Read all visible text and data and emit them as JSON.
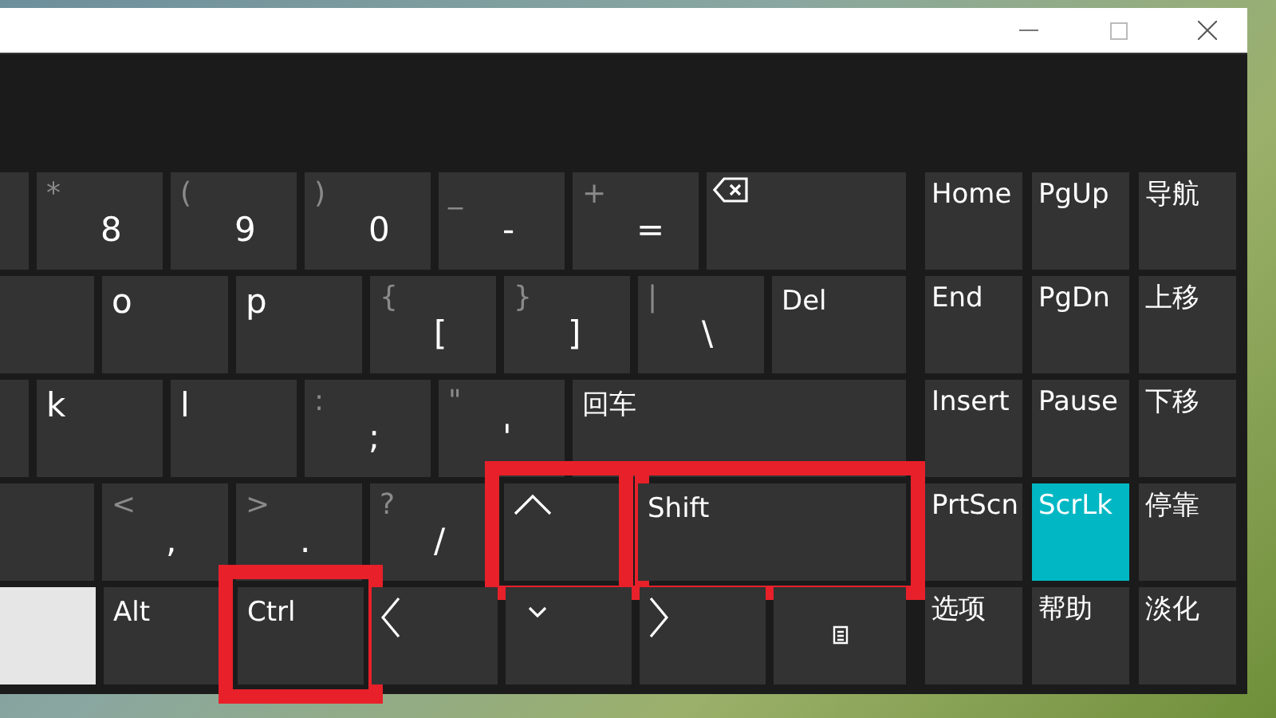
{
  "main_rows": [
    {
      "keys": [
        {
          "kind": "blank",
          "pressed": false,
          "highlighted": false
        },
        {
          "kind": "symbol",
          "shift": "*",
          "main": "8",
          "pressed": false,
          "highlighted": false
        },
        {
          "kind": "symbol",
          "shift": "(",
          "main": "9",
          "pressed": false,
          "highlighted": false
        },
        {
          "kind": "symbol",
          "shift": ")",
          "main": "0",
          "pressed": false,
          "highlighted": false
        },
        {
          "kind": "symbol",
          "shift": "_",
          "main": "-",
          "pressed": false,
          "highlighted": false
        },
        {
          "kind": "symbol",
          "shift": "+",
          "main": "=",
          "pressed": false,
          "highlighted": false
        },
        {
          "kind": "backspace",
          "pressed": false,
          "highlighted": false
        }
      ]
    },
    {
      "keys": [
        {
          "kind": "blank",
          "pressed": false,
          "highlighted": false
        },
        {
          "kind": "label",
          "label": "o",
          "pressed": false,
          "highlighted": false
        },
        {
          "kind": "label",
          "label": "p",
          "pressed": false,
          "highlighted": false
        },
        {
          "kind": "symbol",
          "shift": "{",
          "main": "[",
          "pressed": false,
          "highlighted": false
        },
        {
          "kind": "symbol",
          "shift": "}",
          "main": "]",
          "pressed": false,
          "highlighted": false
        },
        {
          "kind": "symbol",
          "shift": "|",
          "main": "\\",
          "pressed": false,
          "highlighted": false
        },
        {
          "kind": "label",
          "label": "Del",
          "pressed": false,
          "highlighted": false
        }
      ]
    },
    {
      "keys": [
        {
          "kind": "blank",
          "pressed": false,
          "highlighted": false
        },
        {
          "kind": "label",
          "label": "k",
          "pressed": false,
          "highlighted": false
        },
        {
          "kind": "label",
          "label": "l",
          "pressed": false,
          "highlighted": false
        },
        {
          "kind": "symbol",
          "shift": ":",
          "main": ";",
          "pressed": false,
          "highlighted": false
        },
        {
          "kind": "symbol",
          "shift": "\"",
          "main": "'",
          "pressed": false,
          "highlighted": false
        },
        {
          "kind": "label",
          "label": "回车",
          "pressed": false,
          "highlighted": false
        }
      ]
    },
    {
      "keys": [
        {
          "kind": "blank",
          "pressed": false,
          "highlighted": false
        },
        {
          "kind": "symbol",
          "shift": "<",
          "main": ",",
          "pressed": false,
          "highlighted": false
        },
        {
          "kind": "symbol",
          "shift": ">",
          "main": ".",
          "pressed": false,
          "highlighted": false
        },
        {
          "kind": "symbol",
          "shift": "?",
          "main": "/",
          "pressed": false,
          "highlighted": false
        },
        {
          "kind": "up",
          "pressed": false,
          "highlighted": true
        },
        {
          "kind": "label",
          "label": "Shift",
          "pressed": false,
          "highlighted": true
        }
      ]
    },
    {
      "keys": [
        {
          "kind": "blank",
          "pressed": true,
          "highlighted": false
        },
        {
          "kind": "label",
          "label": "Alt",
          "pressed": false,
          "highlighted": false
        },
        {
          "kind": "label",
          "label": "Ctrl",
          "pressed": false,
          "highlighted": true
        },
        {
          "kind": "left",
          "pressed": false,
          "highlighted": false
        },
        {
          "kind": "down",
          "pressed": false,
          "highlighted": false
        },
        {
          "kind": "right",
          "pressed": false,
          "highlighted": false
        },
        {
          "kind": "menu",
          "pressed": false,
          "highlighted": false
        }
      ]
    }
  ],
  "nav_rows": [
    {
      "keys": [
        {
          "label": "Home",
          "on": false
        },
        {
          "label": "PgUp",
          "on": false
        },
        {
          "label": "导航",
          "on": false
        }
      ]
    },
    {
      "keys": [
        {
          "label": "End",
          "on": false
        },
        {
          "label": "PgDn",
          "on": false
        },
        {
          "label": "上移",
          "on": false
        }
      ]
    },
    {
      "keys": [
        {
          "label": "Insert",
          "on": false
        },
        {
          "label": "Pause",
          "on": false
        },
        {
          "label": "下移",
          "on": false
        }
      ]
    },
    {
      "keys": [
        {
          "label": "PrtScn",
          "on": false
        },
        {
          "label": "ScrLk",
          "on": true
        },
        {
          "label": "停靠",
          "on": false
        }
      ]
    },
    {
      "keys": [
        {
          "label": "选项",
          "on": false
        },
        {
          "label": "帮助",
          "on": false
        },
        {
          "label": "淡化",
          "on": false
        }
      ]
    }
  ]
}
